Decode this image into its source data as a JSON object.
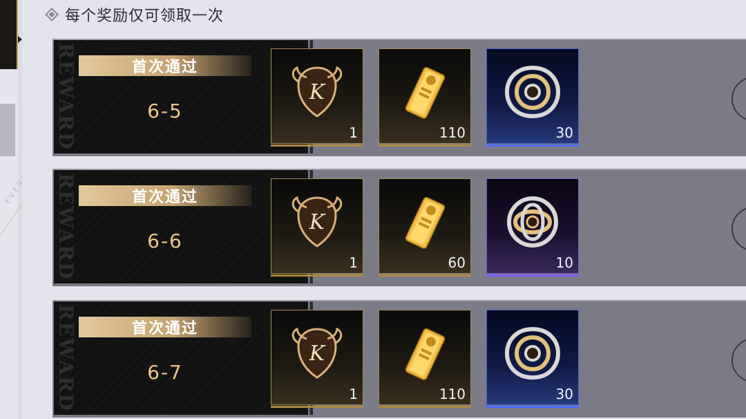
{
  "header": {
    "text": "每个奖励仅可领取一次"
  },
  "rows": [
    {
      "label": "首次通过",
      "stage": "6-5",
      "watermark": "REWARD",
      "items": [
        {
          "icon": "crest-k-icon",
          "count": "1",
          "rarity": "gold"
        },
        {
          "icon": "gold-bar-icon",
          "count": "110",
          "rarity": "gold"
        },
        {
          "icon": "silver-emblem-icon",
          "count": "30",
          "rarity": "blue"
        }
      ]
    },
    {
      "label": "首次通过",
      "stage": "6-6",
      "watermark": "REWARD",
      "items": [
        {
          "icon": "crest-k-icon",
          "count": "1",
          "rarity": "gold"
        },
        {
          "icon": "gold-bar-icon",
          "count": "60",
          "rarity": "gold"
        },
        {
          "icon": "knot-emblem-icon",
          "count": "10",
          "rarity": "purple"
        }
      ]
    },
    {
      "label": "首次通过",
      "stage": "6-7",
      "watermark": "REWARD",
      "items": [
        {
          "icon": "crest-k-icon",
          "count": "1",
          "rarity": "gold"
        },
        {
          "icon": "gold-bar-icon",
          "count": "110",
          "rarity": "gold"
        },
        {
          "icon": "silver-emblem-icon",
          "count": "30",
          "rarity": "blue"
        }
      ]
    }
  ],
  "colors": {
    "gold": "#c6a372",
    "blue": "#4b6cff",
    "purple": "#7c5cff"
  }
}
